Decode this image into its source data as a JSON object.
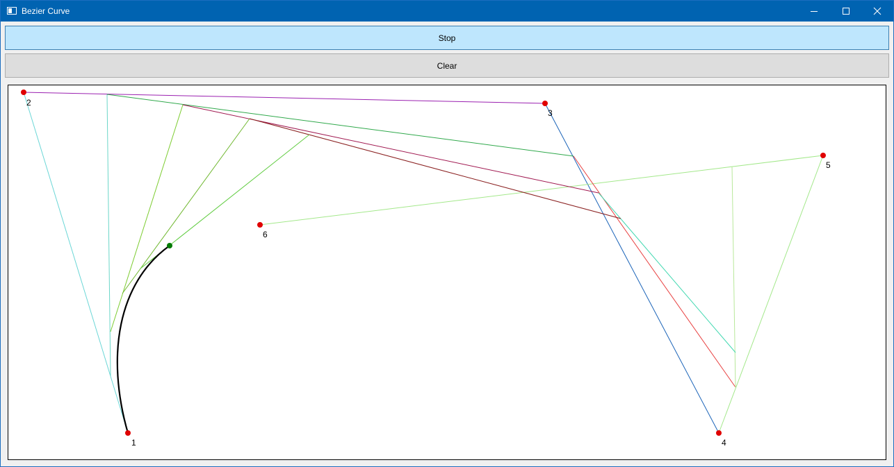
{
  "window": {
    "title": "Bezier Curve",
    "controls": {
      "minimize_icon": "minimize-icon",
      "maximize_icon": "maximize-icon",
      "close_icon": "close-icon"
    }
  },
  "toolbar": {
    "stop_label": "Stop",
    "clear_label": "Clear"
  },
  "canvas": {
    "control_point_color": "#e00000",
    "current_point_color": "#007a00",
    "curve_color": "#000000",
    "control_points": [
      {
        "label": "1"
      },
      {
        "label": "2"
      },
      {
        "label": "3"
      },
      {
        "label": "4"
      },
      {
        "label": "5"
      },
      {
        "label": "6"
      }
    ]
  },
  "colors": {
    "titlebar": "#0063b1",
    "stop_button_bg": "#bee6fd",
    "stop_button_border": "#3c7fb1",
    "clear_button_bg": "#dddddd"
  }
}
